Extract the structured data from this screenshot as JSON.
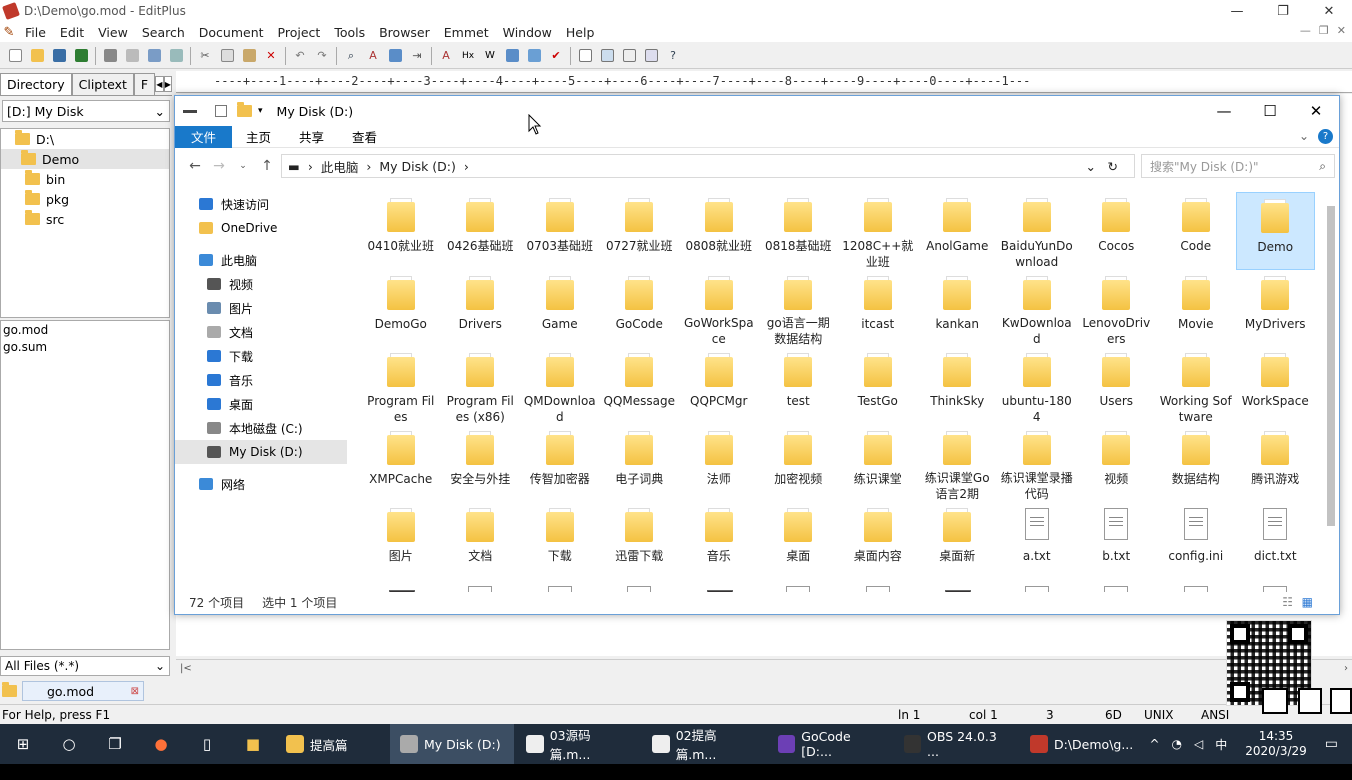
{
  "window": {
    "title": "D:\\Demo\\go.mod - EditPlus"
  },
  "menu": [
    "File",
    "Edit",
    "View",
    "Search",
    "Document",
    "Project",
    "Tools",
    "Browser",
    "Emmet",
    "Window",
    "Help"
  ],
  "left_panel": {
    "tabs": [
      "Directory",
      "Cliptext",
      "F"
    ],
    "drive": "[D:] My Disk",
    "tree": [
      {
        "label": "D:\\",
        "selected": false
      },
      {
        "label": "Demo",
        "selected": true
      },
      {
        "label": "bin",
        "selected": false
      },
      {
        "label": "pkg",
        "selected": false
      },
      {
        "label": "src",
        "selected": false
      }
    ],
    "files": [
      "go.mod",
      "go.sum"
    ],
    "filter": "All Files (*.*)"
  },
  "ruler": "----+----1----+----2----+----3----+----4----+----5----+----6----+----7----+----8----+----9----+----0----+----1---",
  "doc_tab": "go.mod",
  "status": {
    "help": "For Help, press F1",
    "ln": "ln 1",
    "col": "col 1",
    "num": "3",
    "hex": "6D",
    "eol": "UNIX",
    "enc": "ANSI"
  },
  "explorer": {
    "title": "My Disk (D:)",
    "ribbon": [
      "文件",
      "主页",
      "共享",
      "查看"
    ],
    "breadcrumb": [
      "此电脑",
      "My Disk (D:)"
    ],
    "search_placeholder": "搜索\"My Disk (D:)\"",
    "nav": [
      {
        "label": "快速访问",
        "color": "#2b78d4"
      },
      {
        "label": "OneDrive",
        "color": "#f2c14e"
      },
      {
        "label": "此电脑",
        "color": "#3b8ad8"
      },
      {
        "label": "视频",
        "color": "#555"
      },
      {
        "label": "图片",
        "color": "#6a8caf"
      },
      {
        "label": "文档",
        "color": "#aaa"
      },
      {
        "label": "下载",
        "color": "#2b78d4"
      },
      {
        "label": "音乐",
        "color": "#2b78d4"
      },
      {
        "label": "桌面",
        "color": "#2b78d4"
      },
      {
        "label": "本地磁盘 (C:)",
        "color": "#888"
      },
      {
        "label": "My Disk (D:)",
        "color": "#555"
      },
      {
        "label": "网络",
        "color": "#3b8ad8"
      }
    ],
    "items": [
      {
        "name": "0410就业班",
        "type": "folder"
      },
      {
        "name": "0426基础班",
        "type": "folder"
      },
      {
        "name": "0703基础班",
        "type": "folder"
      },
      {
        "name": "0727就业班",
        "type": "folder"
      },
      {
        "name": "0808就业班",
        "type": "folder"
      },
      {
        "name": "0818基础班",
        "type": "folder"
      },
      {
        "name": "1208C++就业班",
        "type": "folder"
      },
      {
        "name": "AnolGame",
        "type": "folder"
      },
      {
        "name": "BaiduYunDownload",
        "type": "folder"
      },
      {
        "name": "Cocos",
        "type": "folder"
      },
      {
        "name": "Code",
        "type": "folder"
      },
      {
        "name": "Demo",
        "type": "folder",
        "selected": true
      },
      {
        "name": "DemoGo",
        "type": "folder"
      },
      {
        "name": "Drivers",
        "type": "folder"
      },
      {
        "name": "Game",
        "type": "folder"
      },
      {
        "name": "GoCode",
        "type": "folder"
      },
      {
        "name": "GoWorkSpace",
        "type": "folder"
      },
      {
        "name": "go语言一期数据结构",
        "type": "folder"
      },
      {
        "name": "itcast",
        "type": "folder"
      },
      {
        "name": "kankan",
        "type": "folder"
      },
      {
        "name": "KwDownload",
        "type": "folder"
      },
      {
        "name": "LenovoDrivers",
        "type": "folder"
      },
      {
        "name": "Movie",
        "type": "folder"
      },
      {
        "name": "MyDrivers",
        "type": "folder"
      },
      {
        "name": "Program Files",
        "type": "folder"
      },
      {
        "name": "Program Files (x86)",
        "type": "folder"
      },
      {
        "name": "QMDownload",
        "type": "folder"
      },
      {
        "name": "QQMessage",
        "type": "folder"
      },
      {
        "name": "QQPCMgr",
        "type": "folder"
      },
      {
        "name": "test",
        "type": "folder"
      },
      {
        "name": "TestGo",
        "type": "folder"
      },
      {
        "name": "ThinkSky",
        "type": "folder"
      },
      {
        "name": "ubuntu-1804",
        "type": "folder"
      },
      {
        "name": "Users",
        "type": "folder"
      },
      {
        "name": "Working Software",
        "type": "folder"
      },
      {
        "name": "WorkSpace",
        "type": "folder"
      },
      {
        "name": "XMPCache",
        "type": "folder"
      },
      {
        "name": "安全与外挂",
        "type": "folder"
      },
      {
        "name": "传智加密器",
        "type": "folder"
      },
      {
        "name": "电子词典",
        "type": "folder"
      },
      {
        "name": "法师",
        "type": "folder"
      },
      {
        "name": "加密视频",
        "type": "folder"
      },
      {
        "name": "练识课堂",
        "type": "folder"
      },
      {
        "name": "练识课堂Go语言2期",
        "type": "folder"
      },
      {
        "name": "练识课堂录播代码",
        "type": "folder"
      },
      {
        "name": "视频",
        "type": "folder"
      },
      {
        "name": "数据结构",
        "type": "folder"
      },
      {
        "name": "腾讯游戏",
        "type": "folder"
      },
      {
        "name": "图片",
        "type": "folder"
      },
      {
        "name": "文档",
        "type": "folder"
      },
      {
        "name": "下载",
        "type": "folder"
      },
      {
        "name": "迅雷下载",
        "type": "folder"
      },
      {
        "name": "音乐",
        "type": "folder"
      },
      {
        "name": "桌面",
        "type": "folder"
      },
      {
        "name": "桌面内容",
        "type": "folder"
      },
      {
        "name": "桌面新",
        "type": "folder"
      },
      {
        "name": "a.txt",
        "type": "doc"
      },
      {
        "name": "b.txt",
        "type": "doc"
      },
      {
        "name": "config.ini",
        "type": "doc"
      },
      {
        "name": "dict.txt",
        "type": "doc"
      },
      {
        "name": "",
        "type": "media"
      },
      {
        "name": "",
        "type": "xls"
      },
      {
        "name": "",
        "type": "doc"
      },
      {
        "name": "",
        "type": "doc"
      },
      {
        "name": "",
        "type": "media"
      },
      {
        "name": "",
        "type": "doc"
      },
      {
        "name": "",
        "type": "xls"
      },
      {
        "name": "",
        "type": "media"
      },
      {
        "name": "",
        "type": "doc"
      },
      {
        "name": "",
        "type": "doc"
      },
      {
        "name": "",
        "type": "doc"
      },
      {
        "name": "",
        "type": "xls"
      }
    ],
    "status_count": "72 个项目",
    "status_selected": "选中 1 个项目"
  },
  "taskbar": {
    "apps": [
      {
        "label": "提高篇",
        "color": "#f2c14e",
        "active": false
      },
      {
        "label": "My Disk (D:)",
        "color": "#aaa",
        "active": true
      },
      {
        "label": "03源码篇.m...",
        "color": "#eee",
        "active": false
      },
      {
        "label": "02提高篇.m...",
        "color": "#eee",
        "active": false
      },
      {
        "label": "GoCode [D:...",
        "color": "#6c3fb5",
        "active": false
      },
      {
        "label": "OBS 24.0.3 ...",
        "color": "#333",
        "active": false
      },
      {
        "label": "D:\\Demo\\g...",
        "color": "#c0392b",
        "active": false
      }
    ],
    "ime": "中",
    "time": "14:35",
    "date": "2020/3/29"
  }
}
